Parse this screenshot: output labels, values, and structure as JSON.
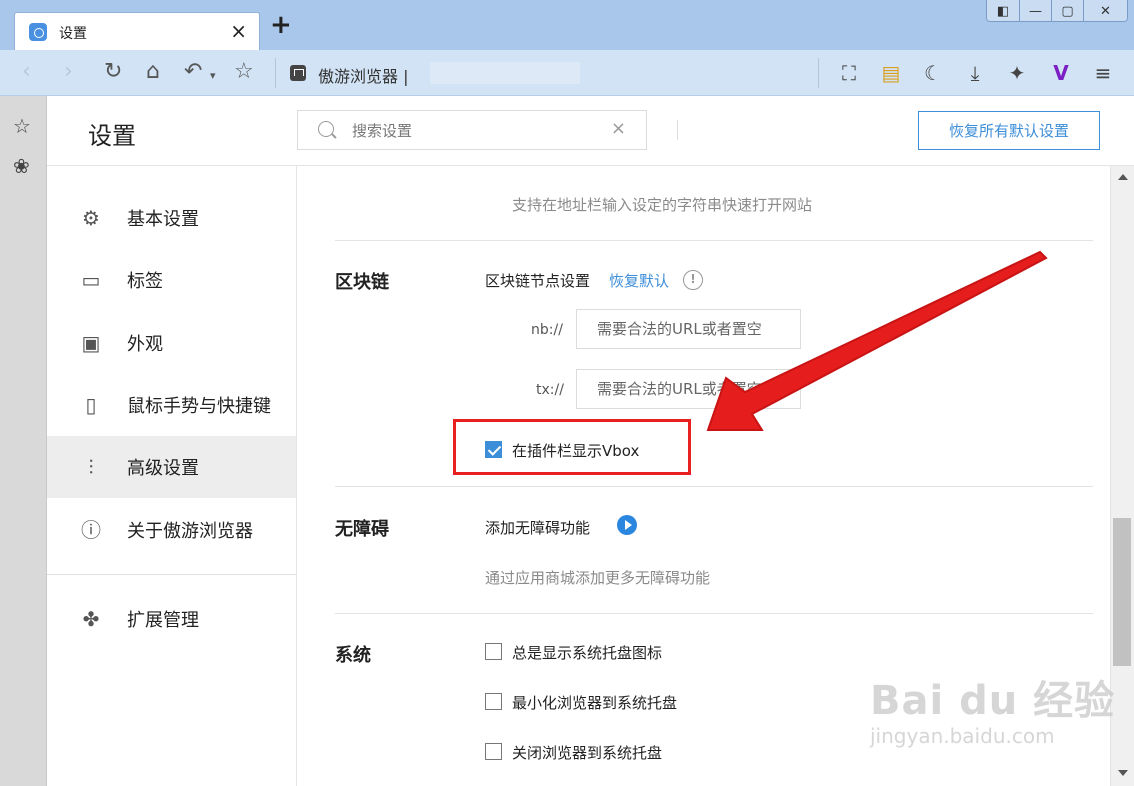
{
  "browser": {
    "tab_title": "设置",
    "tab_close": "×",
    "new_tab": "+",
    "window_buttons": [
      "◧",
      "—",
      "▢",
      "✕"
    ],
    "address_text": "傲游浏览器 |",
    "nav_icons": [
      "back-icon",
      "forward-icon",
      "refresh-icon",
      "home-icon",
      "undo-icon",
      "star-icon"
    ],
    "toolbar_icons": [
      "crop-icon",
      "notes-icon",
      "night-mode-icon",
      "download-icon",
      "extension-icon",
      "v-logo-icon",
      "menu-icon"
    ]
  },
  "settings": {
    "title": "设置",
    "search": {
      "placeholder": "搜索设置",
      "clear": "×"
    },
    "restore_all_label": "恢复所有默认设置",
    "sidebar": [
      {
        "label": "基本设置",
        "icon": "gear-icon"
      },
      {
        "label": "标签",
        "icon": "tab-icon"
      },
      {
        "label": "外观",
        "icon": "window-icon"
      },
      {
        "label": "鼠标手势与快捷键",
        "icon": "mouse-icon"
      },
      {
        "label": "高级设置",
        "icon": "sliders-icon",
        "active": true
      },
      {
        "label": "关于傲游浏览器",
        "icon": "info-icon"
      },
      {
        "label": "扩展管理",
        "icon": "puzzle-icon"
      }
    ]
  },
  "content": {
    "top_hint": "支持在地址栏输入设定的字符串快速打开网站",
    "blockchain": {
      "title": "区块链",
      "node_label": "区块链节点设置",
      "restore_link": "恢复默认",
      "info": "!",
      "nb_prefix": "nb://",
      "nb_placeholder": "需要合法的URL或者置空",
      "tx_prefix": "tx://",
      "tx_placeholder": "需要合法的URL或者置空",
      "vbox_label": "在插件栏显示Vbox",
      "vbox_checked": true
    },
    "accessibility": {
      "title": "无障碍",
      "add_label": "添加无障碍功能",
      "hint": "通过应用商城添加更多无障碍功能"
    },
    "system": {
      "title": "系统",
      "options": [
        {
          "label": "总是显示系统托盘图标",
          "checked": false
        },
        {
          "label": "最小化浏览器到系统托盘",
          "checked": false
        },
        {
          "label": "关闭浏览器到系统托盘",
          "checked": false
        }
      ]
    }
  },
  "watermark": {
    "main": "Bai du 经验",
    "sub": "jingyan.baidu.com"
  },
  "colors": {
    "accent": "#3d8ed8",
    "highlight": "#e82020",
    "titlebar": "#a9c7ea"
  }
}
